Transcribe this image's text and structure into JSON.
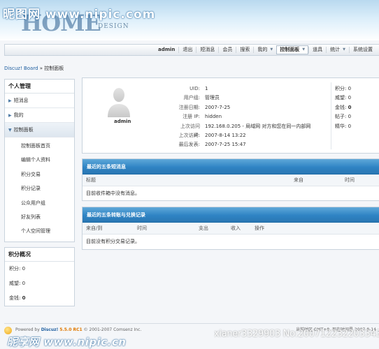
{
  "banner": {
    "watermark": "昵图网 www.nipic.com",
    "brand": "HOME",
    "brand_sub": "DESIGN"
  },
  "nav": {
    "items": [
      "admin",
      "退出",
      "短消息",
      "会员",
      "搜索",
      "我的",
      "控制面板",
      "道具",
      "统计",
      "系统设置"
    ]
  },
  "breadcrumb": {
    "root": "Discuz! Board",
    "sep": "»",
    "current": "控制面板"
  },
  "sidebar": {
    "title": "个人管理",
    "items": [
      {
        "label": "短消息"
      },
      {
        "label": "我的"
      },
      {
        "label": "控制面板"
      }
    ],
    "sub_items": [
      "控制面板首页",
      "编辑个人资料",
      "积分交易",
      "积分记录",
      "公众用户组",
      "好友列表",
      "个人空间管理"
    ],
    "stats_title": "积分概况",
    "stats": [
      {
        "label": "积分:",
        "value": "0"
      },
      {
        "label": "威望:",
        "value": "0"
      },
      {
        "label": "金钱:",
        "value": "0"
      }
    ]
  },
  "profile": {
    "username": "admin",
    "rows": [
      {
        "label": "UID:",
        "value": "1"
      },
      {
        "label": "用户组:",
        "value": "管理员"
      },
      {
        "label": "注册日期:",
        "value": "2007-7-25"
      },
      {
        "label": "注册 IP:",
        "value": "hidden"
      },
      {
        "label": "上次访问 IP:",
        "value": "192.168.0.205 - 局域网 对方和您在同一内部网"
      },
      {
        "label": "上次访问:",
        "value": "2007-8-14 13:22"
      },
      {
        "label": "最后发表:",
        "value": "2007-7-25 15:47"
      }
    ],
    "points": [
      {
        "label": "积分:",
        "value": "0"
      },
      {
        "label": "威望:",
        "value": "0"
      },
      {
        "label": "金钱:",
        "value": "0"
      },
      {
        "label": "帖子:",
        "value": "0"
      },
      {
        "label": "精华:",
        "value": "0"
      }
    ]
  },
  "messages_panel": {
    "title": "最近的五条短消息",
    "col_title": "标题",
    "col_from": "来自",
    "col_time": "时间",
    "empty": "目前收件箱中没有消息。"
  },
  "transfer_panel": {
    "title": "最近的五条转账与兑换记录",
    "col_from": "来自/到",
    "col_time": "时间",
    "col_out": "支出",
    "col_in": "收入",
    "col_action": "操作",
    "empty": "目前没有积分交易记录。"
  },
  "footer": {
    "powered_prefix": "Powered by",
    "product": "Discuz!",
    "version": "5.5.0 RC1",
    "copyright": "© 2001-2007 Comsenz Inc.",
    "timezone": "当前时区 GMT+8, 现在时间是 2007-8-14",
    "watermark": "昵享网 www.nipic.cn",
    "watermark_id": "xianer3329903 No:20071223220334302233"
  }
}
